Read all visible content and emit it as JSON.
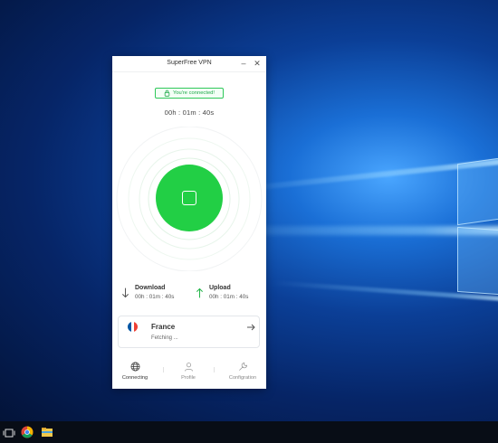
{
  "window": {
    "title": "SuperFree VPN",
    "minimize_glyph": "–",
    "close_glyph": "✕"
  },
  "status": {
    "badge_text": "You're connected!",
    "timer": "00h : 01m : 40s"
  },
  "stats": {
    "download": {
      "label": "Download",
      "value": "00h : 01m : 40s"
    },
    "upload": {
      "label": "Upload",
      "value": "00h : 01m : 40s"
    }
  },
  "location": {
    "country": "France",
    "status": "Fetching ...",
    "flag_colors": [
      "#0055a4",
      "#ffffff",
      "#ef4135"
    ]
  },
  "nav": {
    "items": [
      {
        "label": "Connecting",
        "icon": "globe-icon",
        "active": true
      },
      {
        "label": "Profile",
        "icon": "user-icon",
        "active": false
      },
      {
        "label": "Configration",
        "icon": "wrench-icon",
        "active": false
      }
    ]
  },
  "colors": {
    "accent_green": "#22cf45",
    "badge_green": "#1ea84a",
    "download_arrow": "#555555",
    "upload_arrow": "#22b548"
  },
  "taskbar": {
    "icons": [
      "task-view-icon",
      "chrome-icon",
      "file-explorer-icon"
    ]
  }
}
